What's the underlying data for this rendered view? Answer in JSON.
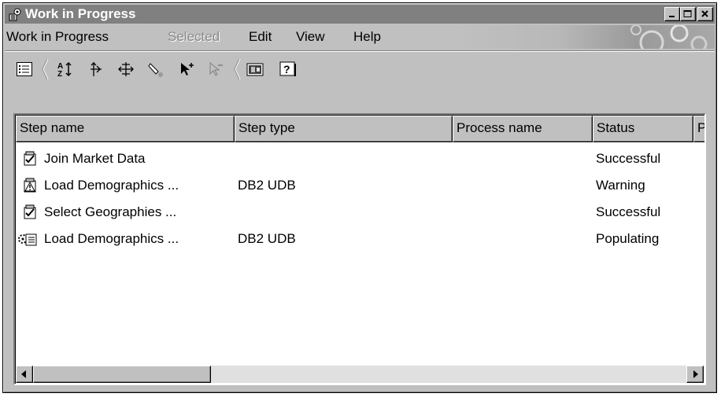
{
  "window": {
    "title": "Work in Progress",
    "app_icon": "work-in-progress-icon",
    "controls": [
      "minimize-icon",
      "maximize-icon",
      "close-icon"
    ]
  },
  "menubar": {
    "items": [
      {
        "label": "Work in Progress",
        "enabled": true
      },
      {
        "label": "Selected",
        "enabled": false
      },
      {
        "label": "Edit",
        "enabled": true
      },
      {
        "label": "View",
        "enabled": true
      },
      {
        "label": "Help",
        "enabled": true
      }
    ]
  },
  "toolbar": {
    "buttons": [
      {
        "icon": "details-view-icon",
        "enabled": true
      },
      {
        "icon": "sort-icon",
        "enabled": true
      },
      {
        "icon": "expand-icon",
        "enabled": true
      },
      {
        "icon": "split-icon",
        "enabled": true
      },
      {
        "icon": "find-icon",
        "enabled": true
      },
      {
        "icon": "select-add-icon",
        "enabled": true
      },
      {
        "icon": "select-remove-icon",
        "enabled": false
      },
      {
        "icon": "log-icon",
        "enabled": true
      },
      {
        "icon": "help-icon",
        "enabled": true
      }
    ],
    "help_glyph": "?"
  },
  "table": {
    "columns": [
      "Step name",
      "Step type",
      "Process name",
      "Status",
      "P"
    ],
    "rows": [
      {
        "icon": "step-successful-icon",
        "step_name": "Join Market Data",
        "step_type": "",
        "process_name": "",
        "status": "Successful"
      },
      {
        "icon": "step-warning-icon",
        "step_name": "Load Demographics ...",
        "step_type": "DB2 UDB",
        "process_name": "",
        "status": "Warning"
      },
      {
        "icon": "step-successful-icon",
        "step_name": "Select Geographies ...",
        "step_type": "",
        "process_name": "",
        "status": "Successful"
      },
      {
        "icon": "step-populating-icon",
        "step_name": "Load Demographics ...",
        "step_type": "DB2 UDB",
        "process_name": "",
        "status": "Populating"
      }
    ]
  },
  "scrollbar": {
    "left_arrow": "left-arrow-icon",
    "right_arrow": "right-arrow-icon"
  },
  "colors": {
    "titlebar": "#808080",
    "face": "#c0c0c0",
    "list_bg": "#ffffff"
  }
}
